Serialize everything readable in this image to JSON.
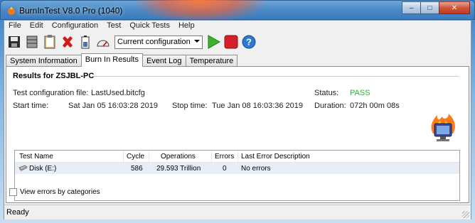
{
  "window": {
    "title": "BurnInTest V8.0 Pro (1040)",
    "controls": {
      "minimize": "–",
      "maximize": "□",
      "close": "✕"
    }
  },
  "menu": [
    "File",
    "Edit",
    "Configuration",
    "Test",
    "Quick Tests",
    "Help"
  ],
  "toolbar": {
    "icons": [
      "save-icon",
      "database-icon",
      "clipboard-icon",
      "clear-x-icon",
      "battery-icon",
      "gauge-icon",
      "play-icon",
      "stop-icon",
      "help-icon"
    ],
    "config_select": "Current configuration"
  },
  "tabs": [
    "System Information",
    "Burn In Results",
    "Event Log",
    "Temperature"
  ],
  "active_tab": "Burn In Results",
  "results": {
    "title": "Results for ZSJBL-PC",
    "config_file_label": "Test configuration file:",
    "config_file_value": "LastUsed.bitcfg",
    "start_label": "Start time:",
    "start_value": "Sat Jan 05 16:03:28 2019",
    "stop_label": "Stop time:",
    "stop_value": "Tue Jan 08 16:03:36 2019",
    "status_label": "Status:",
    "status_value": "PASS",
    "duration_label": "Duration:",
    "duration_value": "072h 00m 08s"
  },
  "grid": {
    "headers": [
      "Test Name",
      "Cycle",
      "Operations",
      "Errors",
      "Last Error Description"
    ],
    "rows": [
      {
        "name": "Disk (E:)",
        "cycle": "586",
        "operations": "29.593 Trillion",
        "errors": "0",
        "last_error": "No errors"
      }
    ]
  },
  "view_errors_label": "View errors by categories",
  "status_bar": "Ready",
  "colors": {
    "pass": "#19c12a",
    "title_glow": "#ff6a3c"
  }
}
